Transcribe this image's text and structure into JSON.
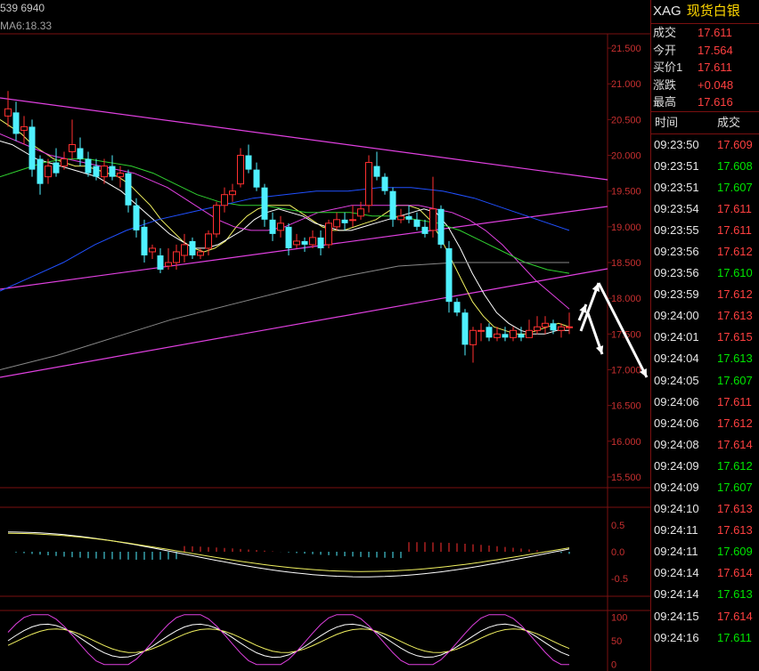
{
  "header": {
    "top_left_text": "539 6940",
    "ma_label": "MA6:18.33"
  },
  "chart_data": {
    "type": "candlestick",
    "title": "",
    "xlabel": "",
    "ylabel": "",
    "ylim": [
      15.35,
      21.7
    ],
    "yticks": [
      "21.500",
      "21.000",
      "20.500",
      "20.000",
      "19.500",
      "19.000",
      "18.500",
      "18.000",
      "17.500",
      "17.000",
      "16.500",
      "16.000",
      "15.500"
    ],
    "candles": [
      [
        20.55,
        20.65,
        20.9,
        20.4
      ],
      [
        20.6,
        20.3,
        20.75,
        20.2
      ],
      [
        20.35,
        20.4,
        20.55,
        20.15
      ],
      [
        20.4,
        19.8,
        20.5,
        19.7
      ],
      [
        19.95,
        19.6,
        20.0,
        19.45
      ],
      [
        19.7,
        19.85,
        19.95,
        19.6
      ],
      [
        19.9,
        19.75,
        20.1,
        19.7
      ],
      [
        19.85,
        19.95,
        20.05,
        19.8
      ],
      [
        20.05,
        20.15,
        20.5,
        19.95
      ],
      [
        20.1,
        19.95,
        20.25,
        19.85
      ],
      [
        19.95,
        19.75,
        20.05,
        19.7
      ],
      [
        19.85,
        19.7,
        19.95,
        19.65
      ],
      [
        19.7,
        19.85,
        19.95,
        19.6
      ],
      [
        19.85,
        19.7,
        20.0,
        19.65
      ],
      [
        19.7,
        19.75,
        19.85,
        19.55
      ],
      [
        19.75,
        19.3,
        19.8,
        19.2
      ],
      [
        19.3,
        18.95,
        19.4,
        18.85
      ],
      [
        19.0,
        18.6,
        19.1,
        18.5
      ],
      [
        18.65,
        18.7,
        18.75,
        18.55
      ],
      [
        18.6,
        18.4,
        18.7,
        18.35
      ],
      [
        18.45,
        18.5,
        18.7,
        18.4
      ],
      [
        18.5,
        18.65,
        18.75,
        18.4
      ],
      [
        18.6,
        18.75,
        18.9,
        18.5
      ],
      [
        18.8,
        18.6,
        18.85,
        18.55
      ],
      [
        18.6,
        18.65,
        18.7,
        18.55
      ],
      [
        18.7,
        18.9,
        18.95,
        18.6
      ],
      [
        18.9,
        19.3,
        19.35,
        18.85
      ],
      [
        19.3,
        19.45,
        19.55,
        19.2
      ],
      [
        19.45,
        19.5,
        19.6,
        19.35
      ],
      [
        19.6,
        20.0,
        20.1,
        19.55
      ],
      [
        20.0,
        19.8,
        20.15,
        19.75
      ],
      [
        19.8,
        19.55,
        19.9,
        19.5
      ],
      [
        19.55,
        19.1,
        19.6,
        19.0
      ],
      [
        19.1,
        18.9,
        19.2,
        18.8
      ],
      [
        18.95,
        19.05,
        19.15,
        18.85
      ],
      [
        19.0,
        18.7,
        19.05,
        18.6
      ],
      [
        18.75,
        18.8,
        18.9,
        18.7
      ],
      [
        18.8,
        18.75,
        18.85,
        18.65
      ],
      [
        18.75,
        18.85,
        18.95,
        18.7
      ],
      [
        18.85,
        18.7,
        18.95,
        18.6
      ],
      [
        18.75,
        19.05,
        19.1,
        18.7
      ],
      [
        19.0,
        19.1,
        19.2,
        18.95
      ],
      [
        19.1,
        19.05,
        19.2,
        18.95
      ],
      [
        19.1,
        19.1,
        19.3,
        19.0
      ],
      [
        19.15,
        19.25,
        19.35,
        19.1
      ],
      [
        19.3,
        19.9,
        20.0,
        19.2
      ],
      [
        19.85,
        19.7,
        20.05,
        19.65
      ],
      [
        19.7,
        19.5,
        19.75,
        19.45
      ],
      [
        19.5,
        19.1,
        19.55,
        19.0
      ],
      [
        19.1,
        19.15,
        19.25,
        19.05
      ],
      [
        19.15,
        19.1,
        19.3,
        19.05
      ],
      [
        19.1,
        19.0,
        19.2,
        18.95
      ],
      [
        19.0,
        18.9,
        19.1,
        18.85
      ],
      [
        18.95,
        19.25,
        19.7,
        18.85
      ],
      [
        19.25,
        18.75,
        19.3,
        18.7
      ],
      [
        18.7,
        17.95,
        18.8,
        17.8
      ],
      [
        17.95,
        17.8,
        18.0,
        17.75
      ],
      [
        17.8,
        17.35,
        17.85,
        17.2
      ],
      [
        17.35,
        17.55,
        17.6,
        17.1
      ],
      [
        17.55,
        17.55,
        17.65,
        17.4
      ],
      [
        17.6,
        17.45,
        17.65,
        17.4
      ],
      [
        17.45,
        17.5,
        17.6,
        17.4
      ],
      [
        17.5,
        17.45,
        17.6,
        17.4
      ],
      [
        17.45,
        17.55,
        17.6,
        17.4
      ],
      [
        17.5,
        17.45,
        17.6,
        17.4
      ],
      [
        17.45,
        17.55,
        17.7,
        17.45
      ],
      [
        17.55,
        17.6,
        17.75,
        17.5
      ],
      [
        17.6,
        17.65,
        17.75,
        17.5
      ],
      [
        17.65,
        17.55,
        17.7,
        17.5
      ],
      [
        17.55,
        17.6,
        17.65,
        17.45
      ],
      [
        17.6,
        17.6,
        17.8,
        17.5
      ]
    ],
    "ma_lines": [
      {
        "color": "#f0f060",
        "values": [
          20.5,
          20.4,
          20.3,
          20.15,
          20.05,
          19.95,
          19.9,
          19.85,
          19.85,
          19.8,
          19.75,
          19.7,
          19.6,
          19.45,
          19.3,
          19.1,
          18.95,
          18.8,
          18.7,
          18.65,
          18.7,
          18.8,
          19.0,
          19.15,
          19.25,
          19.3,
          19.3,
          19.3,
          19.2,
          19.1,
          19.0,
          18.95,
          18.95,
          19.0,
          19.05,
          19.1,
          19.2,
          19.3,
          19.3,
          19.25,
          19.1,
          18.85,
          18.55,
          18.25,
          17.95,
          17.75,
          17.6,
          17.55,
          17.5,
          17.5,
          17.55,
          17.6,
          17.65,
          17.6
        ]
      },
      {
        "color": "#ffffff",
        "values": [
          20.2,
          20.15,
          20.05,
          19.95,
          19.9,
          19.85,
          19.8,
          19.75,
          19.7,
          19.6,
          19.5,
          19.35,
          19.2,
          19.05,
          18.9,
          18.8,
          18.7,
          18.7,
          18.75,
          18.85,
          18.95,
          19.1,
          19.2,
          19.25,
          19.2,
          19.15,
          19.05,
          19.0,
          18.95,
          18.95,
          19.0,
          19.05,
          19.1,
          19.15,
          19.2,
          19.25,
          19.2,
          19.0,
          18.7,
          18.35,
          18.05,
          17.8,
          17.65,
          17.55,
          17.5,
          17.5,
          17.55,
          17.55
        ]
      },
      {
        "color": "#e040e0",
        "values": [
          20.3,
          20.2,
          20.1,
          20.0,
          19.95,
          19.9,
          19.85,
          19.8,
          19.75,
          19.65,
          19.55,
          19.4,
          19.25,
          19.1,
          19.0,
          18.95,
          18.95,
          19.0,
          19.1,
          19.2,
          19.25,
          19.3,
          19.3,
          19.3,
          19.3,
          19.3,
          19.25,
          19.2,
          19.1,
          18.95,
          18.75,
          18.5,
          18.25,
          18.05,
          17.85
        ]
      },
      {
        "color": "#30d030",
        "values": [
          19.7,
          19.8,
          19.9,
          19.95,
          19.95,
          19.9,
          19.85,
          19.75,
          19.6,
          19.45,
          19.35,
          19.3,
          19.3,
          19.25,
          19.2,
          19.2,
          19.2,
          19.15,
          19.15,
          19.1,
          19.05,
          18.95,
          18.8,
          18.65,
          18.5,
          18.4,
          18.35
        ]
      },
      {
        "color": "#2050ff",
        "values": [
          18.1,
          18.3,
          18.5,
          18.75,
          18.95,
          19.1,
          19.2,
          19.3,
          19.4,
          19.45,
          19.5,
          19.5,
          19.55,
          19.55,
          19.5,
          19.4,
          19.25,
          19.1,
          18.95
        ]
      },
      {
        "color": "#888888",
        "values": [
          17.0,
          17.2,
          17.45,
          17.7,
          17.9,
          18.1,
          18.3,
          18.45,
          18.5,
          18.5,
          18.5
        ]
      }
    ]
  },
  "macd_panel": {
    "ticks": [
      "0.5",
      "0.0",
      "-0.5"
    ],
    "ylim": [
      -0.8,
      0.8
    ]
  },
  "kdj_panel": {
    "ticks": [
      "100",
      "50",
      "0"
    ],
    "ylim": [
      -10,
      110
    ]
  },
  "quote": {
    "symbol": "XAG",
    "name": "现货白银",
    "fields": [
      {
        "label": "成交",
        "value": "17.611"
      },
      {
        "label": "今开",
        "value": "17.564"
      },
      {
        "label": "买价1",
        "value": "17.611"
      },
      {
        "label": "涨跌",
        "value": "+0.048"
      },
      {
        "label": "最高",
        "value": "17.616"
      }
    ],
    "col_time": "时间",
    "col_price": "成交",
    "ticks": [
      {
        "time": "09:23:50",
        "price": "17.609"
      },
      {
        "time": "09:23:51",
        "price": "17.608"
      },
      {
        "time": "09:23:51",
        "price": "17.607"
      },
      {
        "time": "09:23:54",
        "price": "17.611"
      },
      {
        "time": "09:23:55",
        "price": "17.611"
      },
      {
        "time": "09:23:56",
        "price": "17.612"
      },
      {
        "time": "09:23:56",
        "price": "17.610"
      },
      {
        "time": "09:23:59",
        "price": "17.612"
      },
      {
        "time": "09:24:00",
        "price": "17.613"
      },
      {
        "time": "09:24:01",
        "price": "17.615"
      },
      {
        "time": "09:24:04",
        "price": "17.613"
      },
      {
        "time": "09:24:05",
        "price": "17.607"
      },
      {
        "time": "09:24:06",
        "price": "17.611"
      },
      {
        "time": "09:24:06",
        "price": "17.612"
      },
      {
        "time": "09:24:08",
        "price": "17.614"
      },
      {
        "time": "09:24:09",
        "price": "17.612"
      },
      {
        "time": "09:24:09",
        "price": "17.607"
      },
      {
        "time": "09:24:10",
        "price": "17.613"
      },
      {
        "time": "09:24:11",
        "price": "17.613"
      },
      {
        "time": "09:24:11",
        "price": "17.609"
      },
      {
        "time": "09:24:14",
        "price": "17.614"
      },
      {
        "time": "09:24:14",
        "price": "17.613"
      },
      {
        "time": "09:24:15",
        "price": "17.614"
      },
      {
        "time": "09:24:16",
        "price": "17.611"
      }
    ]
  }
}
